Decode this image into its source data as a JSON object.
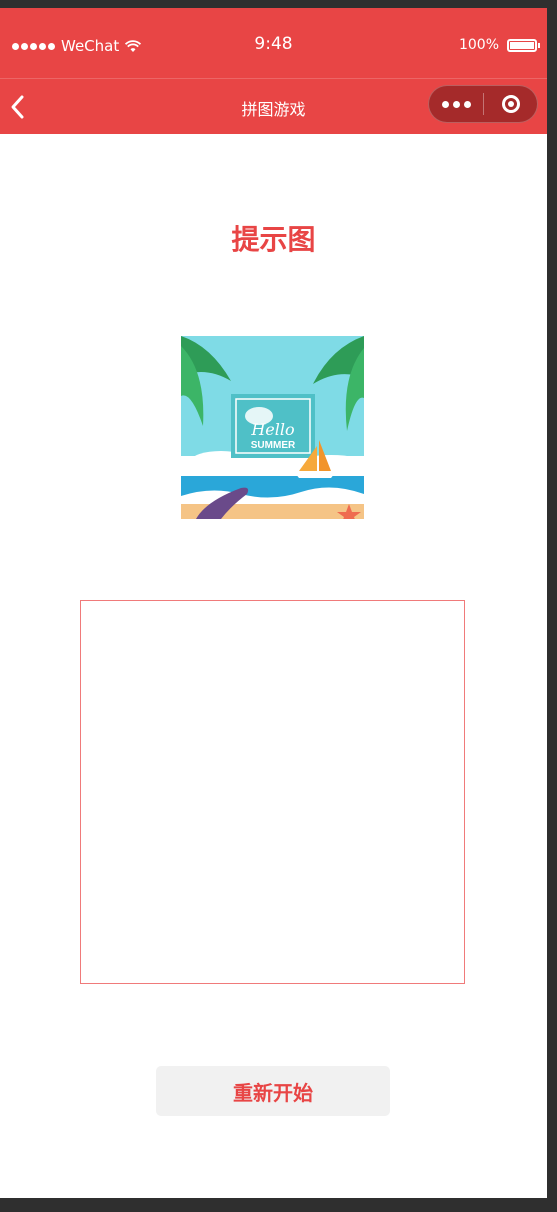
{
  "status_bar": {
    "carrier": "WeChat",
    "time": "9:48",
    "battery": "100%",
    "icons": [
      "signal-dots-icon",
      "wifi-icon",
      "battery-icon"
    ]
  },
  "nav_bar": {
    "title": "拼图游戏",
    "icons": [
      "back-icon",
      "more-icon",
      "close-miniprogram-icon"
    ],
    "background_color": "#e84545"
  },
  "main": {
    "hint_title": "提示图",
    "hint_image_text": {
      "line1": "Hello",
      "line2": "SUMMER"
    },
    "restart_label": "重新开始",
    "accent_color": "#e84545"
  }
}
